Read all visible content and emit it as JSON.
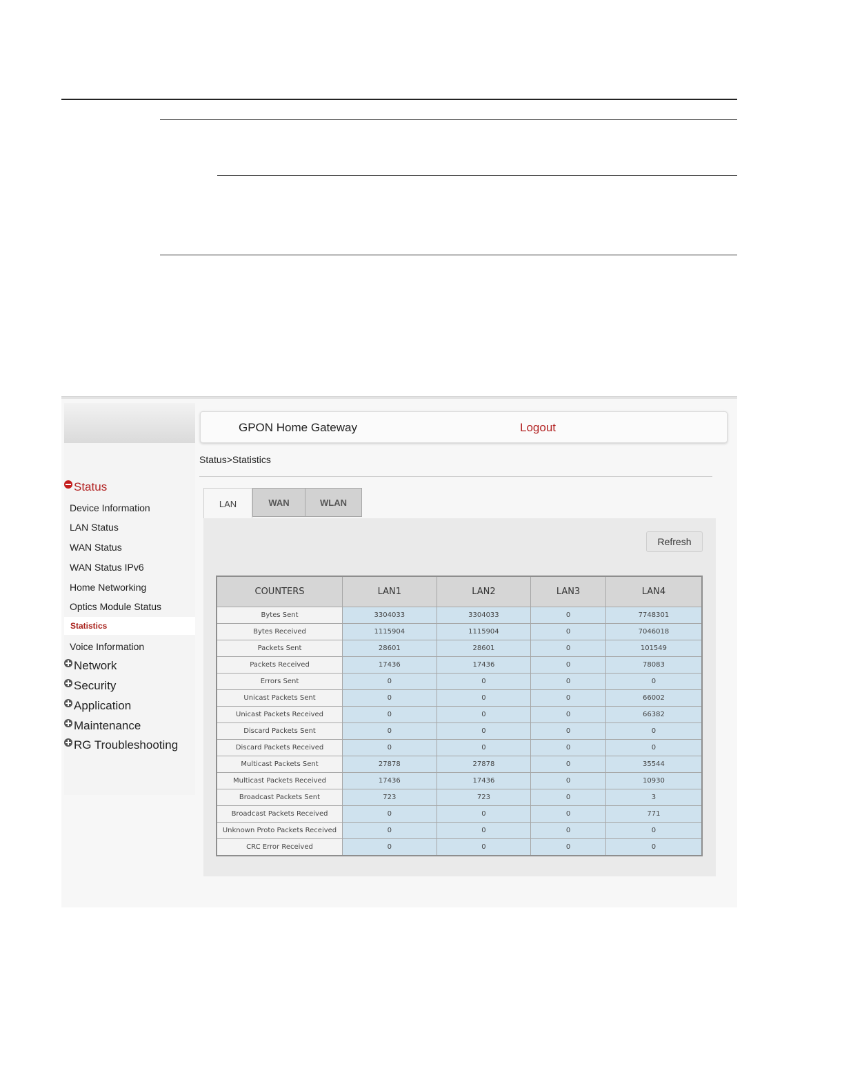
{
  "app": {
    "title": "GPON Home Gateway",
    "logout_label": "Logout"
  },
  "breadcrumb": "Status>Statistics",
  "sidebar": {
    "status_label": "Status",
    "status_items": [
      "Device Information",
      "LAN Status",
      "WAN Status",
      "WAN Status IPv6",
      "Home Networking",
      "Optics Module Status",
      "Statistics",
      "Voice Information"
    ],
    "active_item": "Statistics",
    "groups": [
      "Network",
      "Security",
      "Application",
      "Maintenance",
      "RG Troubleshooting"
    ]
  },
  "tabs": [
    {
      "label": "LAN",
      "active": true
    },
    {
      "label": "WAN",
      "active": false
    },
    {
      "label": "WLAN",
      "active": false
    }
  ],
  "refresh_label": "Refresh",
  "table": {
    "headers": [
      "COUNTERS",
      "LAN1",
      "LAN2",
      "LAN3",
      "LAN4"
    ],
    "rows": [
      [
        "Bytes Sent",
        "3304033",
        "3304033",
        "0",
        "7748301"
      ],
      [
        "Bytes Received",
        "1115904",
        "1115904",
        "0",
        "7046018"
      ],
      [
        "Packets Sent",
        "28601",
        "28601",
        "0",
        "101549"
      ],
      [
        "Packets Received",
        "17436",
        "17436",
        "0",
        "78083"
      ],
      [
        "Errors Sent",
        "0",
        "0",
        "0",
        "0"
      ],
      [
        "Unicast Packets Sent",
        "0",
        "0",
        "0",
        "66002"
      ],
      [
        "Unicast Packets Received",
        "0",
        "0",
        "0",
        "66382"
      ],
      [
        "Discard Packets Sent",
        "0",
        "0",
        "0",
        "0"
      ],
      [
        "Discard Packets Received",
        "0",
        "0",
        "0",
        "0"
      ],
      [
        "Multicast Packets Sent",
        "27878",
        "27878",
        "0",
        "35544"
      ],
      [
        "Multicast Packets Received",
        "17436",
        "17436",
        "0",
        "10930"
      ],
      [
        "Broadcast Packets Sent",
        "723",
        "723",
        "0",
        "3"
      ],
      [
        "Broadcast Packets Received",
        "0",
        "0",
        "0",
        "771"
      ],
      [
        "Unknown Proto Packets Received",
        "0",
        "0",
        "0",
        "0"
      ],
      [
        "CRC Error Received",
        "0",
        "0",
        "0",
        "0"
      ]
    ]
  },
  "colors": {
    "accent": "#b22222",
    "value_cell": "#cfe2ee",
    "header_cell": "#d6d6d6"
  }
}
